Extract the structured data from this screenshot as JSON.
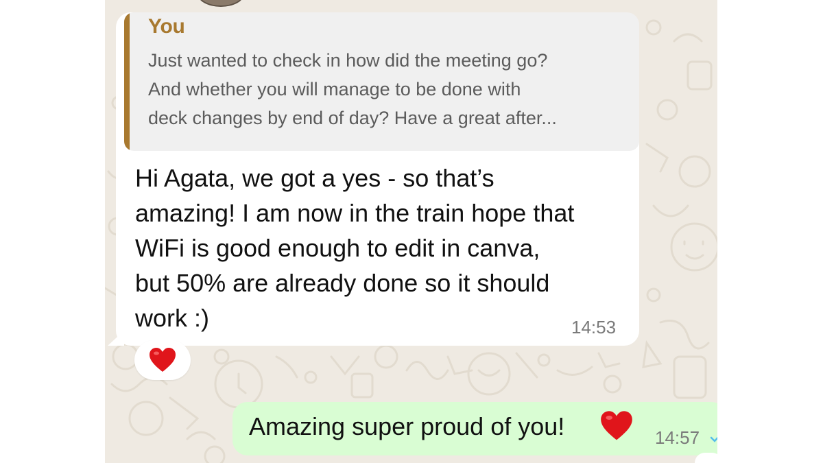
{
  "colors": {
    "wallpaper": "#efeae2",
    "incoming_bubble": "#ffffff",
    "outgoing_bubble": "#d9fdd3",
    "quote_background": "#f0f0f0",
    "quote_accent": "#a8792f",
    "timestamp": "#7a7a7a",
    "read_tick": "#53bdeb",
    "heart": "#e0151b"
  },
  "incoming_message": {
    "quoted": {
      "author": "You",
      "lines": [
        "Just wanted to check in how did the meeting go?",
        "And whether you will manage to be done with",
        "deck changes by end of day? Have a great after..."
      ]
    },
    "lines": [
      "Hi Agata, we got a yes - so that’s",
      "amazing! I am now in the train hope that",
      "WiFi is good enough to edit in canva,",
      "but 50% are already done so it should",
      "work :)"
    ],
    "time": "14:53",
    "reaction_icon": "red-heart-icon"
  },
  "outgoing_message": {
    "text": "Amazing super proud of you!",
    "emoji_icon": "red-heart-icon",
    "time": "14:57",
    "status_icon": "read-tick-icon"
  }
}
